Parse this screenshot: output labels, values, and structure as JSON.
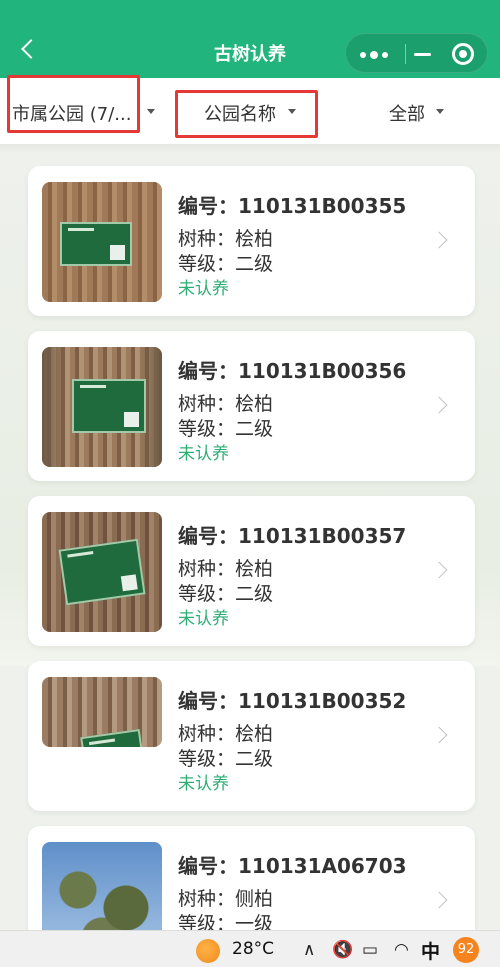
{
  "header": {
    "title": "古树认养",
    "back_icon": "chevron-left-icon",
    "capsule_more_icon": "more-dots-icon",
    "capsule_minimize_icon": "minimize-icon",
    "capsule_close_icon": "target-close-icon"
  },
  "filters": [
    {
      "label": "市属公园 (7/...",
      "highlighted": true
    },
    {
      "label": "公园名称",
      "highlighted": true
    },
    {
      "label": "全部",
      "highlighted": false
    }
  ],
  "trees": [
    {
      "code": "编号：110131B00355",
      "species": "树种：桧柏",
      "grade": "等级：二级",
      "status": "未认养"
    },
    {
      "code": "编号：110131B00356",
      "species": "树种：桧柏",
      "grade": "等级：二级",
      "status": "未认养"
    },
    {
      "code": "编号：110131B00357",
      "species": "树种：桧柏",
      "grade": "等级：二级",
      "status": "未认养"
    },
    {
      "code": "编号：110131B00352",
      "species": "树种：桧柏",
      "grade": "等级：二级",
      "status": "未认养"
    },
    {
      "code": "编号：110131A06703",
      "species": "树种：侧柏",
      "grade": "等级：一级",
      "status": ""
    }
  ],
  "taskbar": {
    "temperature": "28°C",
    "ime": "中",
    "notification_count": "92"
  },
  "colors": {
    "brand_green": "#21b47c",
    "status_green": "#2eae75",
    "highlight_red": "#e53935"
  }
}
